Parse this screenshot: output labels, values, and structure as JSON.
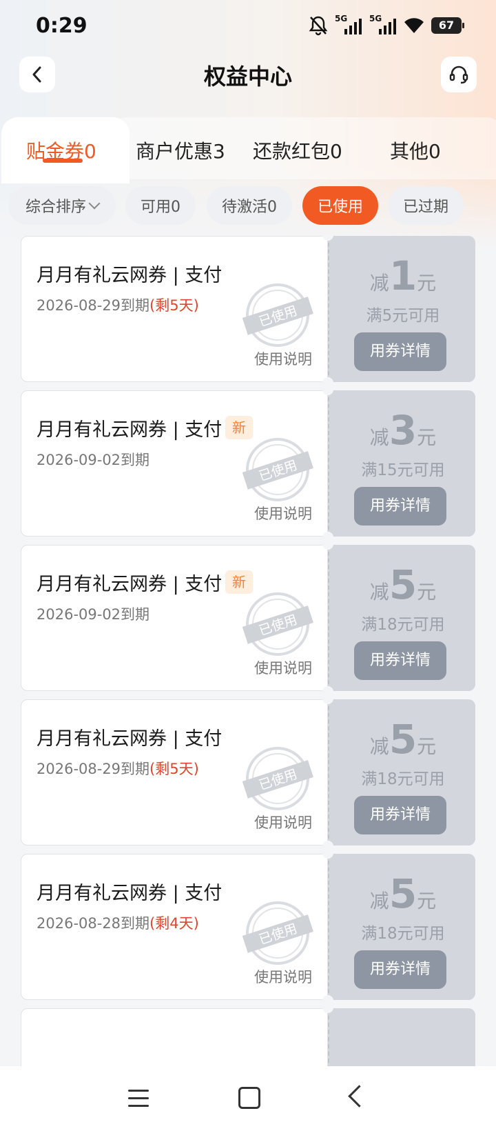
{
  "status_bar": {
    "time": "0:29",
    "signal1": "5G",
    "signal2": "5G",
    "battery": "67"
  },
  "header": {
    "title": "权益中心",
    "back_icon": "arrow-left-icon",
    "service_icon": "headset-icon"
  },
  "tabs": [
    {
      "label": "贴金券0",
      "active": true
    },
    {
      "label": "商户优惠3"
    },
    {
      "label": "还款红包0"
    },
    {
      "label": "其他0"
    }
  ],
  "filters": [
    {
      "label": "综合排序"
    },
    {
      "label": "可用0"
    },
    {
      "label": "待激活0"
    },
    {
      "label": "已使用",
      "active": true
    },
    {
      "label": "已过期"
    }
  ],
  "coupon_common": {
    "stamp_text": "已使用",
    "help_label": "使用说明",
    "detail_label": "用券详情",
    "amount_prefix": "减",
    "amount_unit": "元"
  },
  "coupons": [
    {
      "title": "月月有礼云网券 | 支付",
      "date": "2026-08-29到期",
      "remain": "(剩5天)",
      "new": "",
      "amount": "1",
      "condition": "满5元可用"
    },
    {
      "title": "月月有礼云网券 | 支付",
      "date": "2026-09-02到期",
      "remain": "",
      "new": "新",
      "amount": "3",
      "condition": "满15元可用"
    },
    {
      "title": "月月有礼云网券 | 支付",
      "date": "2026-09-02到期",
      "remain": "",
      "new": "新",
      "amount": "5",
      "condition": "满18元可用"
    },
    {
      "title": "月月有礼云网券 | 支付",
      "date": "2026-08-29到期",
      "remain": "(剩5天)",
      "new": "",
      "amount": "5",
      "condition": "满18元可用"
    },
    {
      "title": "月月有礼云网券 | 支付",
      "date": "2026-08-28到期",
      "remain": "(剩4天)",
      "new": "",
      "amount": "5",
      "condition": "满18元可用"
    }
  ],
  "colors": {
    "accent": "#f25a24",
    "used_panel": "#d3d6dc",
    "button_gray": "#8e96a3"
  }
}
